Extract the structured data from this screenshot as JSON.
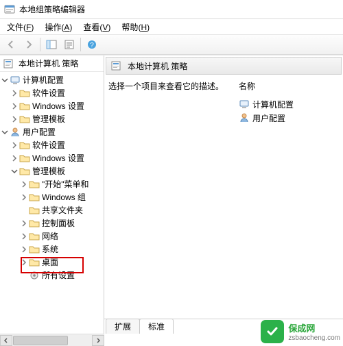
{
  "window": {
    "title": "本地组策略编辑器"
  },
  "menu": {
    "file": "文件",
    "file_accel": "F",
    "action": "操作",
    "action_accel": "A",
    "view": "查看",
    "view_accel": "V",
    "help": "帮助",
    "help_accel": "H"
  },
  "tree": {
    "root": "本地计算机 策略",
    "computer_config": "计算机配置",
    "software_settings": "软件设置",
    "windows_settings": "Windows 设置",
    "admin_templates": "管理模板",
    "user_config": "用户配置",
    "start_menu_and": "\"开始\"菜单和",
    "windows_comp": "Windows 组",
    "shared_folders": "共享文件夹",
    "control_panel": "控制面板",
    "network": "网络",
    "system": "系统",
    "desktop": "桌面",
    "all_settings": "所有设置"
  },
  "right": {
    "header": "本地计算机 策略",
    "desc": "选择一个项目来查看它的描述。",
    "col_name": "名称",
    "items": {
      "computer_config": "计算机配置",
      "user_config": "用户配置"
    }
  },
  "tabs": {
    "extended": "扩展",
    "standard": "标准"
  },
  "watermark": {
    "brand": "保成网",
    "url": "zsbaocheng.com"
  }
}
